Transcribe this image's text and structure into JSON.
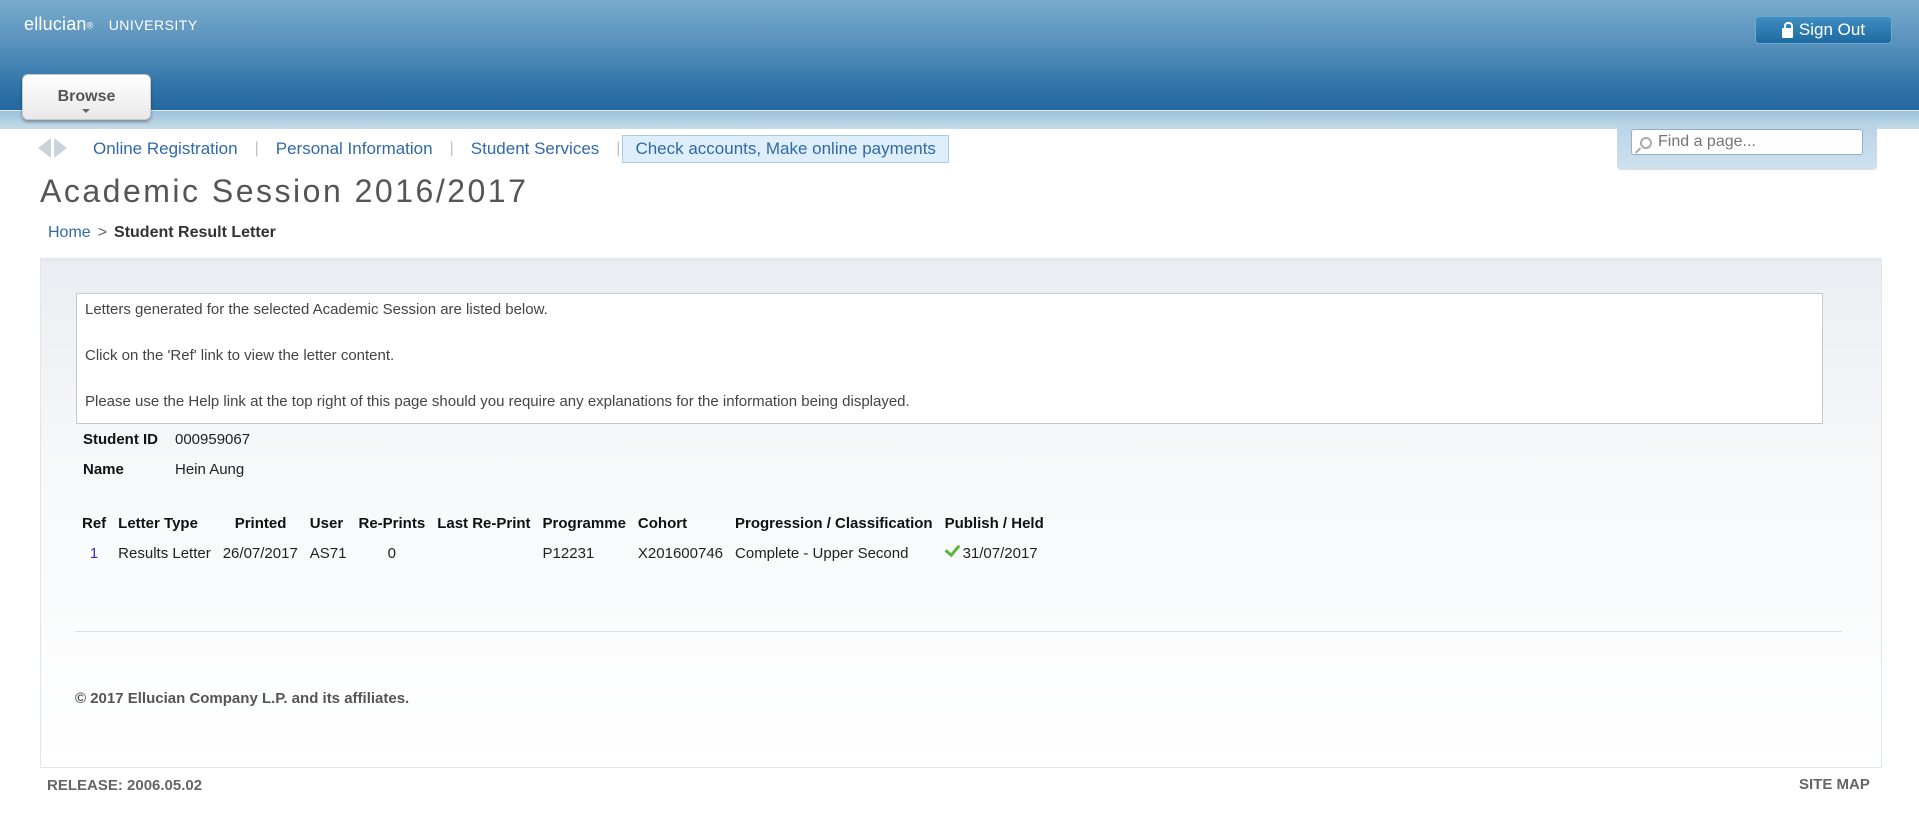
{
  "header": {
    "brand": "ellucian",
    "brand_mark": "®",
    "university": "UNIVERSITY",
    "signout_label": "Sign Out",
    "browse_label": "Browse"
  },
  "nav": {
    "items": [
      {
        "label": "Online Registration"
      },
      {
        "label": "Personal Information"
      },
      {
        "label": "Student Services"
      },
      {
        "label": "Check accounts, Make online payments",
        "active": true
      }
    ],
    "search_placeholder": "Find a page..."
  },
  "page": {
    "title": "Academic Session 2016/2017",
    "breadcrumb": {
      "home": "Home",
      "separator": ">",
      "current": "Student Result Letter"
    }
  },
  "info": {
    "lines": [
      "Letters generated for the selected Academic Session are listed below.",
      "Click on the 'Ref' link to view the letter content.",
      "Please use the Help link at the top right of this page should you require any explanations for the information being displayed."
    ]
  },
  "student": {
    "id_label": "Student ID",
    "id_value": "000959067",
    "name_label": "Name",
    "name_value": "Hein Aung"
  },
  "table": {
    "headers": [
      "Ref",
      "Letter Type",
      "Printed",
      "User",
      "Re-Prints",
      "Last Re-Print",
      "Programme",
      "Cohort",
      "Progression / Classification",
      "Publish / Held"
    ],
    "rows": [
      {
        "ref": "1",
        "letter_type": "Results Letter",
        "printed": "26/07/2017",
        "user": "AS71",
        "reprints": "0",
        "last_reprint": "",
        "programme": "P12231",
        "cohort": "X201600746",
        "progression": "Complete - Upper Second",
        "publish_icon": "check-icon",
        "publish_date": "31/07/2017"
      }
    ]
  },
  "footer": {
    "copyright": "© 2017 Ellucian Company L.P. and its affiliates.",
    "release": "RELEASE: 2006.05.02",
    "sitemap": "SITE MAP"
  },
  "colors": {
    "header_top": "#79abcd",
    "header_bottom": "#1f649a",
    "link": "#2f6aa6",
    "check": "#5cb83c"
  }
}
